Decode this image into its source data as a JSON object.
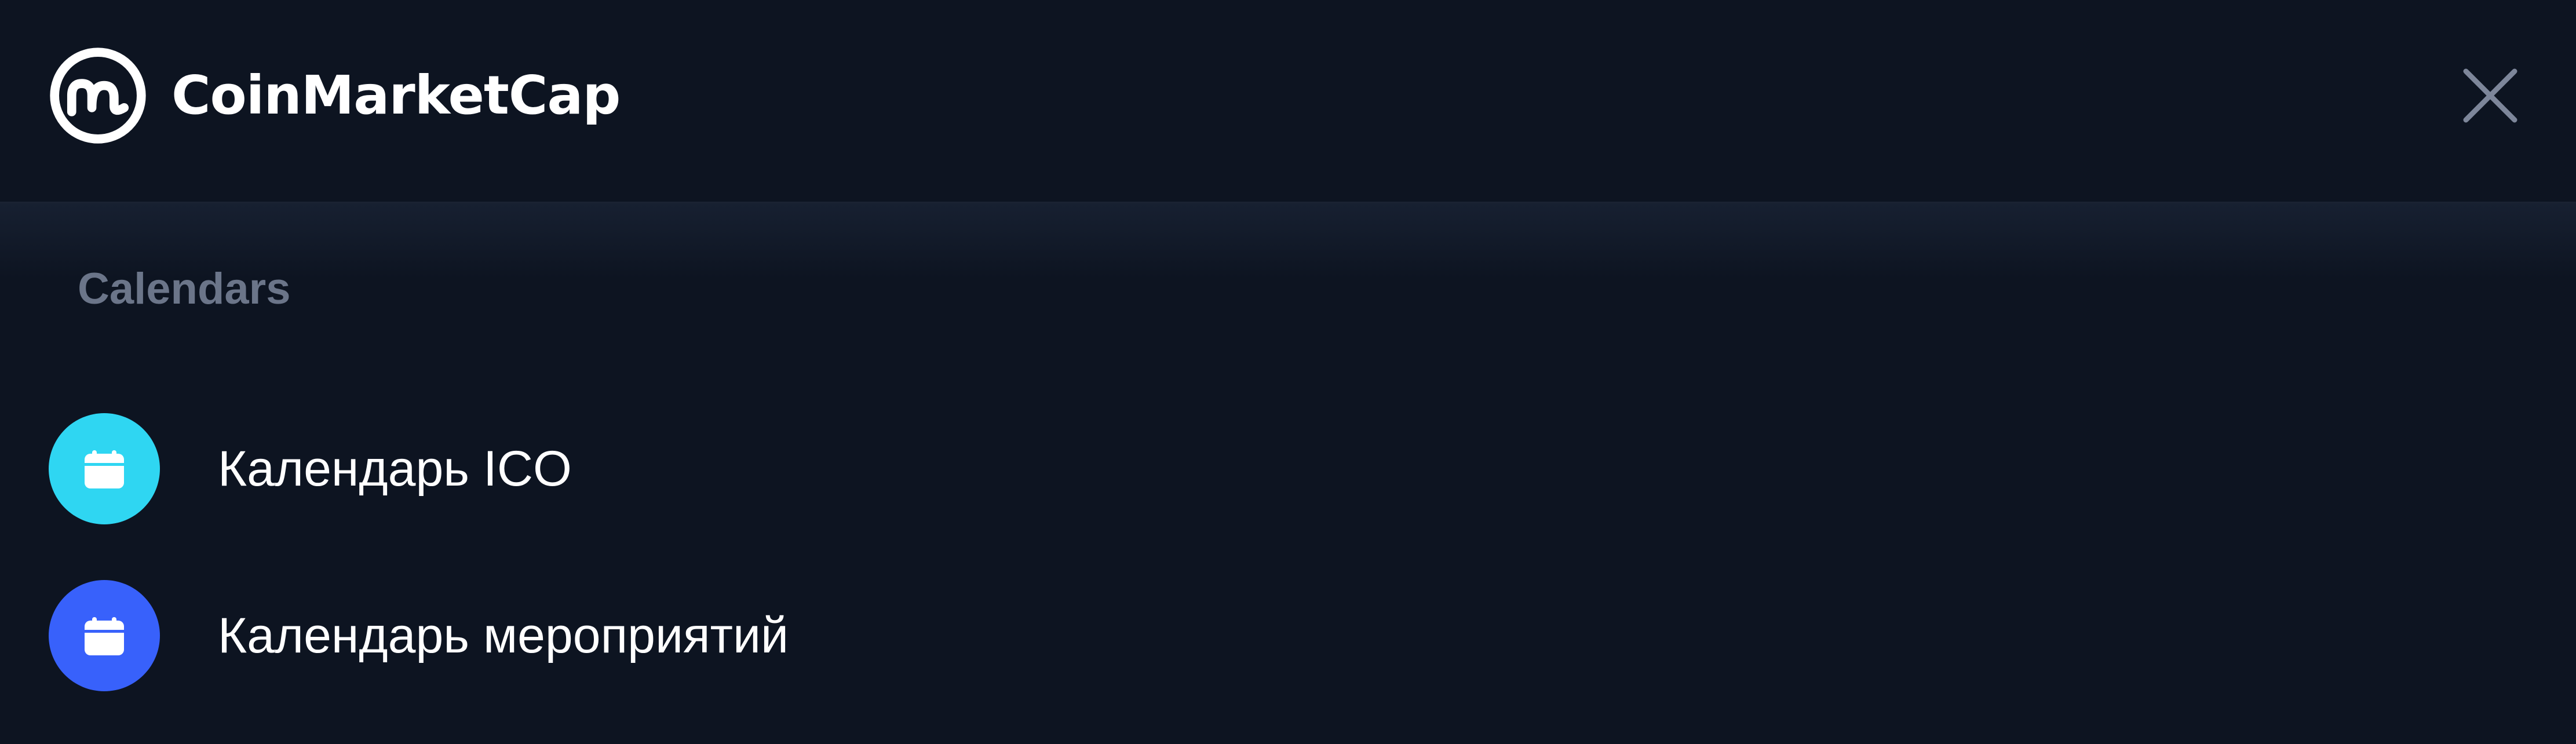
{
  "header": {
    "brand": "CoinMarketCap",
    "logo_icon": "coinmarketcap-logo-icon",
    "close_icon": "close-icon"
  },
  "section": {
    "title": "Calendars"
  },
  "items": [
    {
      "label": "Календарь ICO",
      "icon": "calendar-icon",
      "color": "#2fd6f2"
    },
    {
      "label": "Календарь мероприятий",
      "icon": "calendar-icon",
      "color": "#3861fb"
    }
  ],
  "colors": {
    "background": "#0d1421",
    "header_divider": "#1a2232",
    "section_title": "#6b7589",
    "text": "#ffffff",
    "close_icon": "#7d869a"
  }
}
